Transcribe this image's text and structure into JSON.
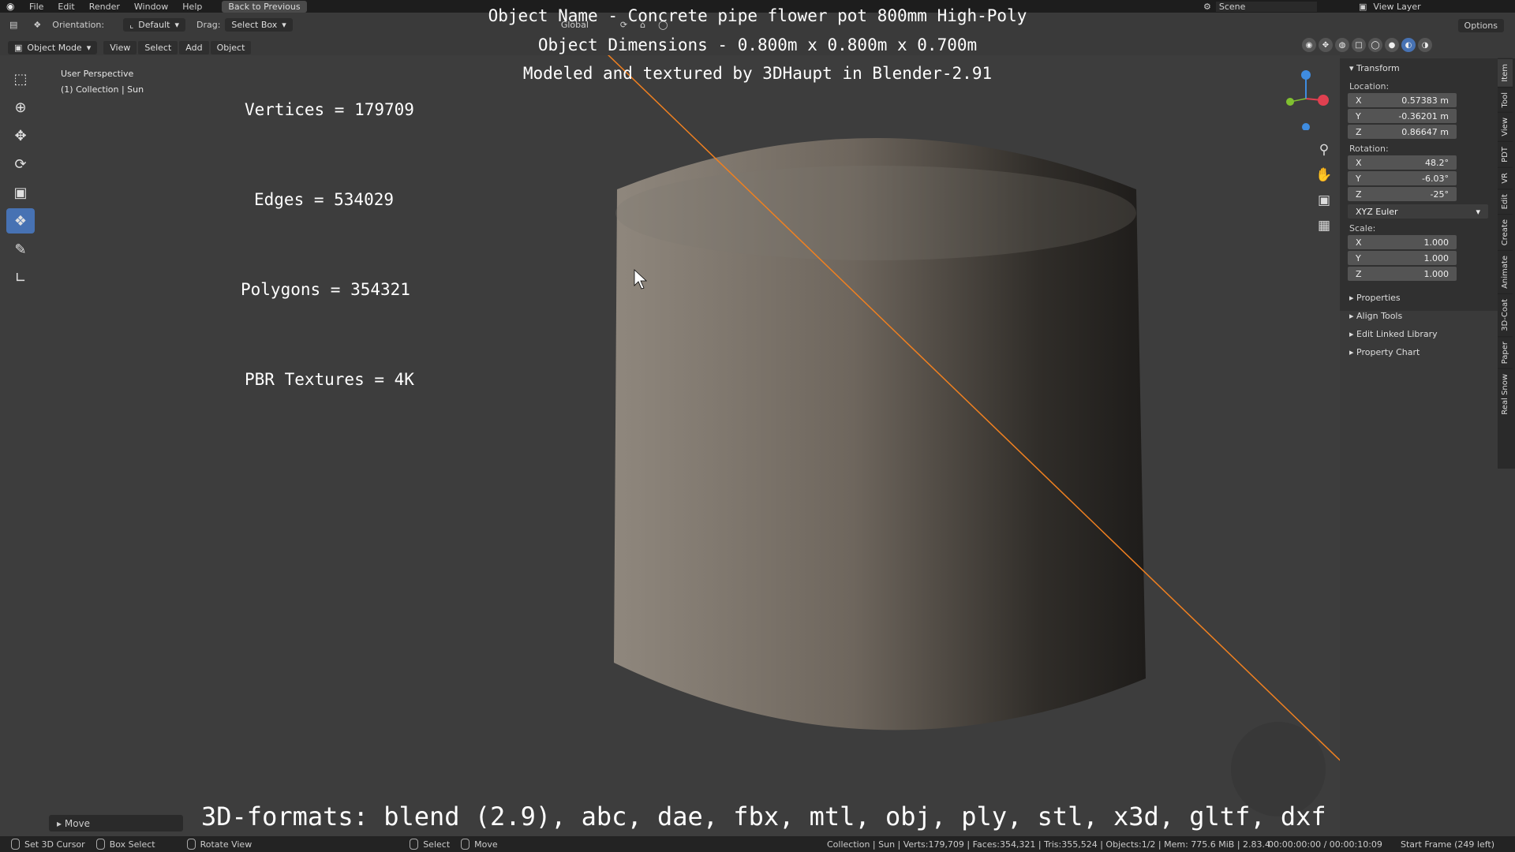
{
  "menu": {
    "items": [
      "File",
      "Edit",
      "Render",
      "Window",
      "Help"
    ],
    "back_button": "Back to Previous",
    "scene_label": "Scene",
    "view_layer_label": "View Layer"
  },
  "header": {
    "orientation_label": "Orientation:",
    "orientation_value": "Default",
    "drag_label": "Drag:",
    "drag_value": "Select Box",
    "transform_space": "Global",
    "options_label": "Options",
    "mode": "Object Mode",
    "menus": [
      "View",
      "Select",
      "Add",
      "Object"
    ]
  },
  "viewport": {
    "perspective": "User Perspective",
    "collection": "(1) Collection | Sun",
    "stats": {
      "vertices": "Vertices = 179709",
      "edges": "Edges = 534029",
      "polygons": "Polygons = 354321",
      "textures": "PBR Textures = 4K"
    },
    "overlay": {
      "name": "Object Name - Concrete pipe flower pot 800mm High-Poly",
      "dimensions": "Object Dimensions -  0.800m x 0.800m x 0.700m",
      "credit": "Modeled and textured by 3DHaupt in Blender-2.91"
    },
    "formats": "3D-formats: blend (2.9), abc, dae, fbx, mtl, obj, ply, stl, x3d, gltf, dxf",
    "move_panel": "Move"
  },
  "npanel": {
    "transform_header": "Transform",
    "location_label": "Location:",
    "location": [
      {
        "axis": "X",
        "value": "0.57383 m"
      },
      {
        "axis": "Y",
        "value": "-0.36201 m"
      },
      {
        "axis": "Z",
        "value": "0.86647 m"
      }
    ],
    "rotation_label": "Rotation:",
    "rotation": [
      {
        "axis": "X",
        "value": "48.2°"
      },
      {
        "axis": "Y",
        "value": "-6.03°"
      },
      {
        "axis": "Z",
        "value": "-25°"
      }
    ],
    "rotation_mode": "XYZ Euler",
    "scale_label": "Scale:",
    "scale": [
      {
        "axis": "X",
        "value": "1.000"
      },
      {
        "axis": "Y",
        "value": "1.000"
      },
      {
        "axis": "Z",
        "value": "1.000"
      }
    ],
    "collapsed": [
      "Properties",
      "Align Tools",
      "Edit Linked Library",
      "Property Chart"
    ]
  },
  "sidetabs": [
    "Item",
    "Tool",
    "View",
    "PDT",
    "VR",
    "Edit",
    "Create",
    "Animate",
    "3D-Coat",
    "Paper",
    "Real Snow"
  ],
  "statusbar": {
    "set_cursor": "Set 3D Cursor",
    "box_select": "Box Select",
    "rotate_view": "Rotate View",
    "select": "Select",
    "move": "Move",
    "scene_stats": "Collection | Sun | Verts:179,709 | Faces:354,321 | Tris:355,524 | Objects:1/2 | Mem: 775.6 MiB | 2.83.4",
    "time": "00:00:00:00 / 00:00:10:09",
    "frame": "Start Frame (249 left)"
  },
  "colors": {
    "active_tool": "#4772b3",
    "selection_line": "#f08020",
    "axis_x": "#e04050",
    "axis_y": "#80c030",
    "axis_z": "#3f8ce0"
  }
}
